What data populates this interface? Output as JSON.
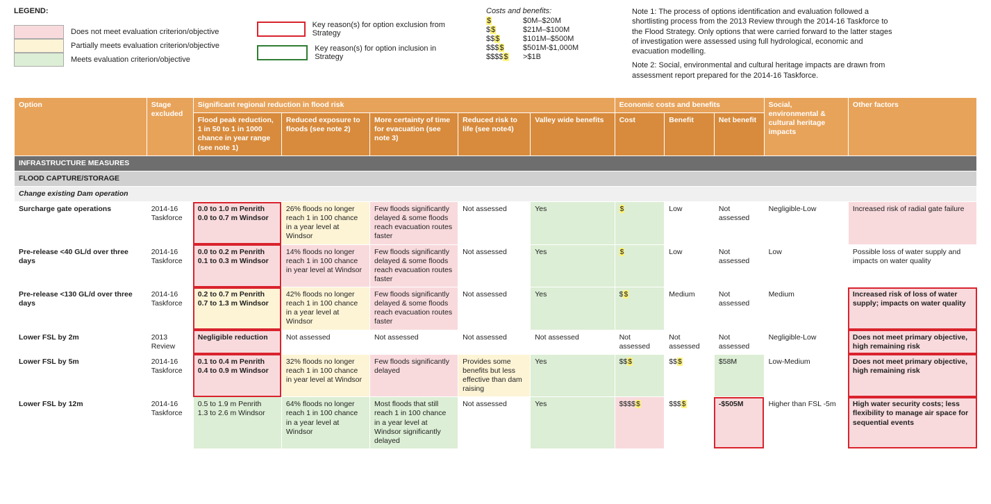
{
  "legend": {
    "title": "LEGEND:",
    "criteria": [
      {
        "label": "Does not meet evaluation criterion/objective",
        "swatch": "sw-pink"
      },
      {
        "label": "Partially meets evaluation criterion/objective",
        "swatch": "sw-yellow"
      },
      {
        "label": "Meets evaluation criterion/objective",
        "swatch": "sw-green"
      }
    ],
    "boxes": [
      {
        "label": "Key reason(s) for option exclusion from Strategy",
        "swatch": "sw-red-border"
      },
      {
        "label": "Key reason(s) for option inclusion in Strategy",
        "swatch": "sw-green-border"
      }
    ],
    "costs": {
      "header": "Costs and benefits:",
      "rows": [
        {
          "sym": "$",
          "hl": 1,
          "range": "$0M–$20M"
        },
        {
          "sym": "$$",
          "hl": 1,
          "range": "$21M–$100M"
        },
        {
          "sym": "$$$",
          "hl": 1,
          "range": "$101M–$500M"
        },
        {
          "sym": "$$$$",
          "hl": 1,
          "range": "$501M-$1,000M"
        },
        {
          "sym": "$$$$$",
          "hl": 1,
          "range": ">$1B"
        }
      ]
    },
    "notes": {
      "n1": "Note 1: The process of options identification and evaluation followed a shortlisting process from the 2013 Review through the 2014-16 Taskforce to the Flood Strategy. Only options that were carried forward to the latter stages of investigation were assessed using full hydrological, economic and evacuation modelling.",
      "n2": "Note 2: Social, environmental and cultural heritage impacts are drawn from assessment report prepared for the 2014-16 Taskforce."
    }
  },
  "headers": {
    "option": "Option",
    "stage": "Stage excluded",
    "group_risk": "Significant regional reduction in flood risk",
    "peak": "Flood peak reduction, 1 in 50 to 1 in 1000 chance in year  range (see note 1)",
    "exposure": "Reduced exposure to floods (see note 2)",
    "certainty": "More certainty of time for evacuation (see note 3)",
    "life": "Reduced risk to life (see note4)",
    "valley": "Valley wide benefits",
    "group_econ": "Economic costs and benefits",
    "cost": "Cost",
    "benefit": "Benefit",
    "net": "Net benefit",
    "social": "Social, environmental & cultural heritage impacts",
    "other": "Other factors"
  },
  "sections": {
    "infra": "INFRASTRUCTURE MEASURES",
    "flood": "FLOOD CAPTURE/STORAGE",
    "dam": "Change existing Dam operation"
  },
  "rows": [
    {
      "name": "Surcharge gate operations",
      "stage": "2014-16 Taskforce",
      "peak": {
        "t": "0.0 to 1.0 m Penrith\n0.0 to 0.7 m Windsor",
        "bg": "pink",
        "box": "red",
        "bold": true
      },
      "exposure": {
        "t": "26% floods no longer reach 1 in 100 chance in a year level at Windsor",
        "bg": "yellow"
      },
      "certainty": {
        "t": "Few floods significantly delayed & some floods reach evacuation routes faster",
        "bg": "pink"
      },
      "life": {
        "t": "Not assessed",
        "bg": "white"
      },
      "valley": {
        "t": "Yes",
        "bg": "green"
      },
      "cost": {
        "t": "$",
        "bg": "green",
        "hl": true
      },
      "benefit": {
        "t": "Low",
        "bg": "white"
      },
      "net": {
        "t": "Not assessed",
        "bg": "white"
      },
      "social": {
        "t": "Negligible-Low",
        "bg": "white"
      },
      "other": {
        "t": "Increased risk of radial gate failure",
        "bg": "pink"
      }
    },
    {
      "name": "Pre-release <40 GL/d over three days",
      "stage": "2014-16 Taskforce",
      "peak": {
        "t": "0.0 to 0.2 m Penrith\n0.1 to 0.3 m Windsor",
        "bg": "pink",
        "box": "red",
        "bold": true
      },
      "exposure": {
        "t": "14% floods no longer reach 1 in 100 chance in year level at Windsor",
        "bg": "pink"
      },
      "certainty": {
        "t": "Few floods significantly delayed & some floods reach evacuation routes faster",
        "bg": "pink"
      },
      "life": {
        "t": "Not assessed",
        "bg": "white"
      },
      "valley": {
        "t": "Yes",
        "bg": "green"
      },
      "cost": {
        "t": "$",
        "bg": "green",
        "hl": true
      },
      "benefit": {
        "t": "Low",
        "bg": "white"
      },
      "net": {
        "t": "Not assessed",
        "bg": "white"
      },
      "social": {
        "t": "Low",
        "bg": "white"
      },
      "other": {
        "t": "Possible loss of water supply and impacts on water quality",
        "bg": "white"
      }
    },
    {
      "name": "Pre-release <130 GL/d over three days",
      "stage": "2014-16 Taskforce",
      "peak": {
        "t": "0.2 to 0.7 m Penrith\n0.7 to 1.3 m Windsor",
        "bg": "yellow",
        "box": "red",
        "bold": true
      },
      "exposure": {
        "t": "42% floods no longer reach 1 in 100 chance in a year level at Windsor",
        "bg": "yellow"
      },
      "certainty": {
        "t": "Few floods significantly delayed & some floods reach evacuation routes faster",
        "bg": "pink"
      },
      "life": {
        "t": "Not assessed",
        "bg": "white"
      },
      "valley": {
        "t": "Yes",
        "bg": "green"
      },
      "cost": {
        "t": "$$",
        "bg": "green",
        "hl": true
      },
      "benefit": {
        "t": "Medium",
        "bg": "white"
      },
      "net": {
        "t": "Not assessed",
        "bg": "white"
      },
      "social": {
        "t": "Medium",
        "bg": "white"
      },
      "other": {
        "t": "Increased risk of loss of water supply; impacts on water quality",
        "bg": "pink",
        "box": "red",
        "bold": true
      }
    },
    {
      "name": "Lower FSL by 2m",
      "stage": "2013 Review",
      "peak": {
        "t": "Negligible reduction",
        "bg": "pink",
        "box": "red",
        "bold": true
      },
      "exposure": {
        "t": "Not assessed",
        "bg": "white"
      },
      "certainty": {
        "t": "Not assessed",
        "bg": "white"
      },
      "life": {
        "t": "Not assessed",
        "bg": "white"
      },
      "valley": {
        "t": "Not assessed",
        "bg": "white"
      },
      "cost": {
        "t": "Not assessed",
        "bg": "white"
      },
      "benefit": {
        "t": "Not assessed",
        "bg": "white"
      },
      "net": {
        "t": "Not assessed",
        "bg": "white"
      },
      "social": {
        "t": "Negligible-Low",
        "bg": "white"
      },
      "other": {
        "t": "Does not meet primary objective, high remaining risk",
        "bg": "pink",
        "box": "red",
        "bold": true
      }
    },
    {
      "name": "Lower FSL by 5m",
      "stage": "2014-16 Taskforce",
      "peak": {
        "t": "0.1 to 0.4 m Penrith\n0.4 to 0.9 m Windsor",
        "bg": "pink",
        "box": "red",
        "bold": true
      },
      "exposure": {
        "t": "32% floods no longer reach 1 in 100 chance in year level at Windsor",
        "bg": "yellow"
      },
      "certainty": {
        "t": "Few floods significantly delayed",
        "bg": "pink"
      },
      "life": {
        "t": "Provides some benefits but less effective than dam raising",
        "bg": "yellow"
      },
      "valley": {
        "t": "Yes",
        "bg": "green"
      },
      "cost": {
        "t": "$$$",
        "bg": "green",
        "hl": true
      },
      "benefit": {
        "t": "$$$",
        "bg": "white",
        "hl": true
      },
      "net": {
        "t": "$58M",
        "bg": "green"
      },
      "social": {
        "t": "Low-Medium",
        "bg": "white"
      },
      "other": {
        "t": "Does not meet primary objective, high remaining risk",
        "bg": "pink",
        "box": "red",
        "bold": true
      }
    },
    {
      "name": "Lower FSL by 12m",
      "stage": "2014-16 Taskforce",
      "peak": {
        "t": "0.5 to 1.9 m Penrith\n1.3 to 2.6 m Windsor",
        "bg": "green"
      },
      "exposure": {
        "t": "64% floods no longer reach 1 in 100 chance in a year level at Windsor",
        "bg": "green"
      },
      "certainty": {
        "t": "Most floods that still reach 1 in 100 chance in a year level at Windsor significantly delayed",
        "bg": "green"
      },
      "life": {
        "t": "Not assessed",
        "bg": "white"
      },
      "valley": {
        "t": "Yes",
        "bg": "green"
      },
      "cost": {
        "t": "$$$$$",
        "bg": "pink",
        "hl": true
      },
      "benefit": {
        "t": "$$$$",
        "bg": "white",
        "hl": true
      },
      "net": {
        "t": "-$505M",
        "bg": "pink",
        "box": "red",
        "bold": true
      },
      "social": {
        "t": "Higher than FSL -5m",
        "bg": "white"
      },
      "other": {
        "t": "High water security costs; less flexibility to manage air space for sequential events",
        "bg": "pink",
        "box": "red",
        "bold": true
      }
    }
  ]
}
